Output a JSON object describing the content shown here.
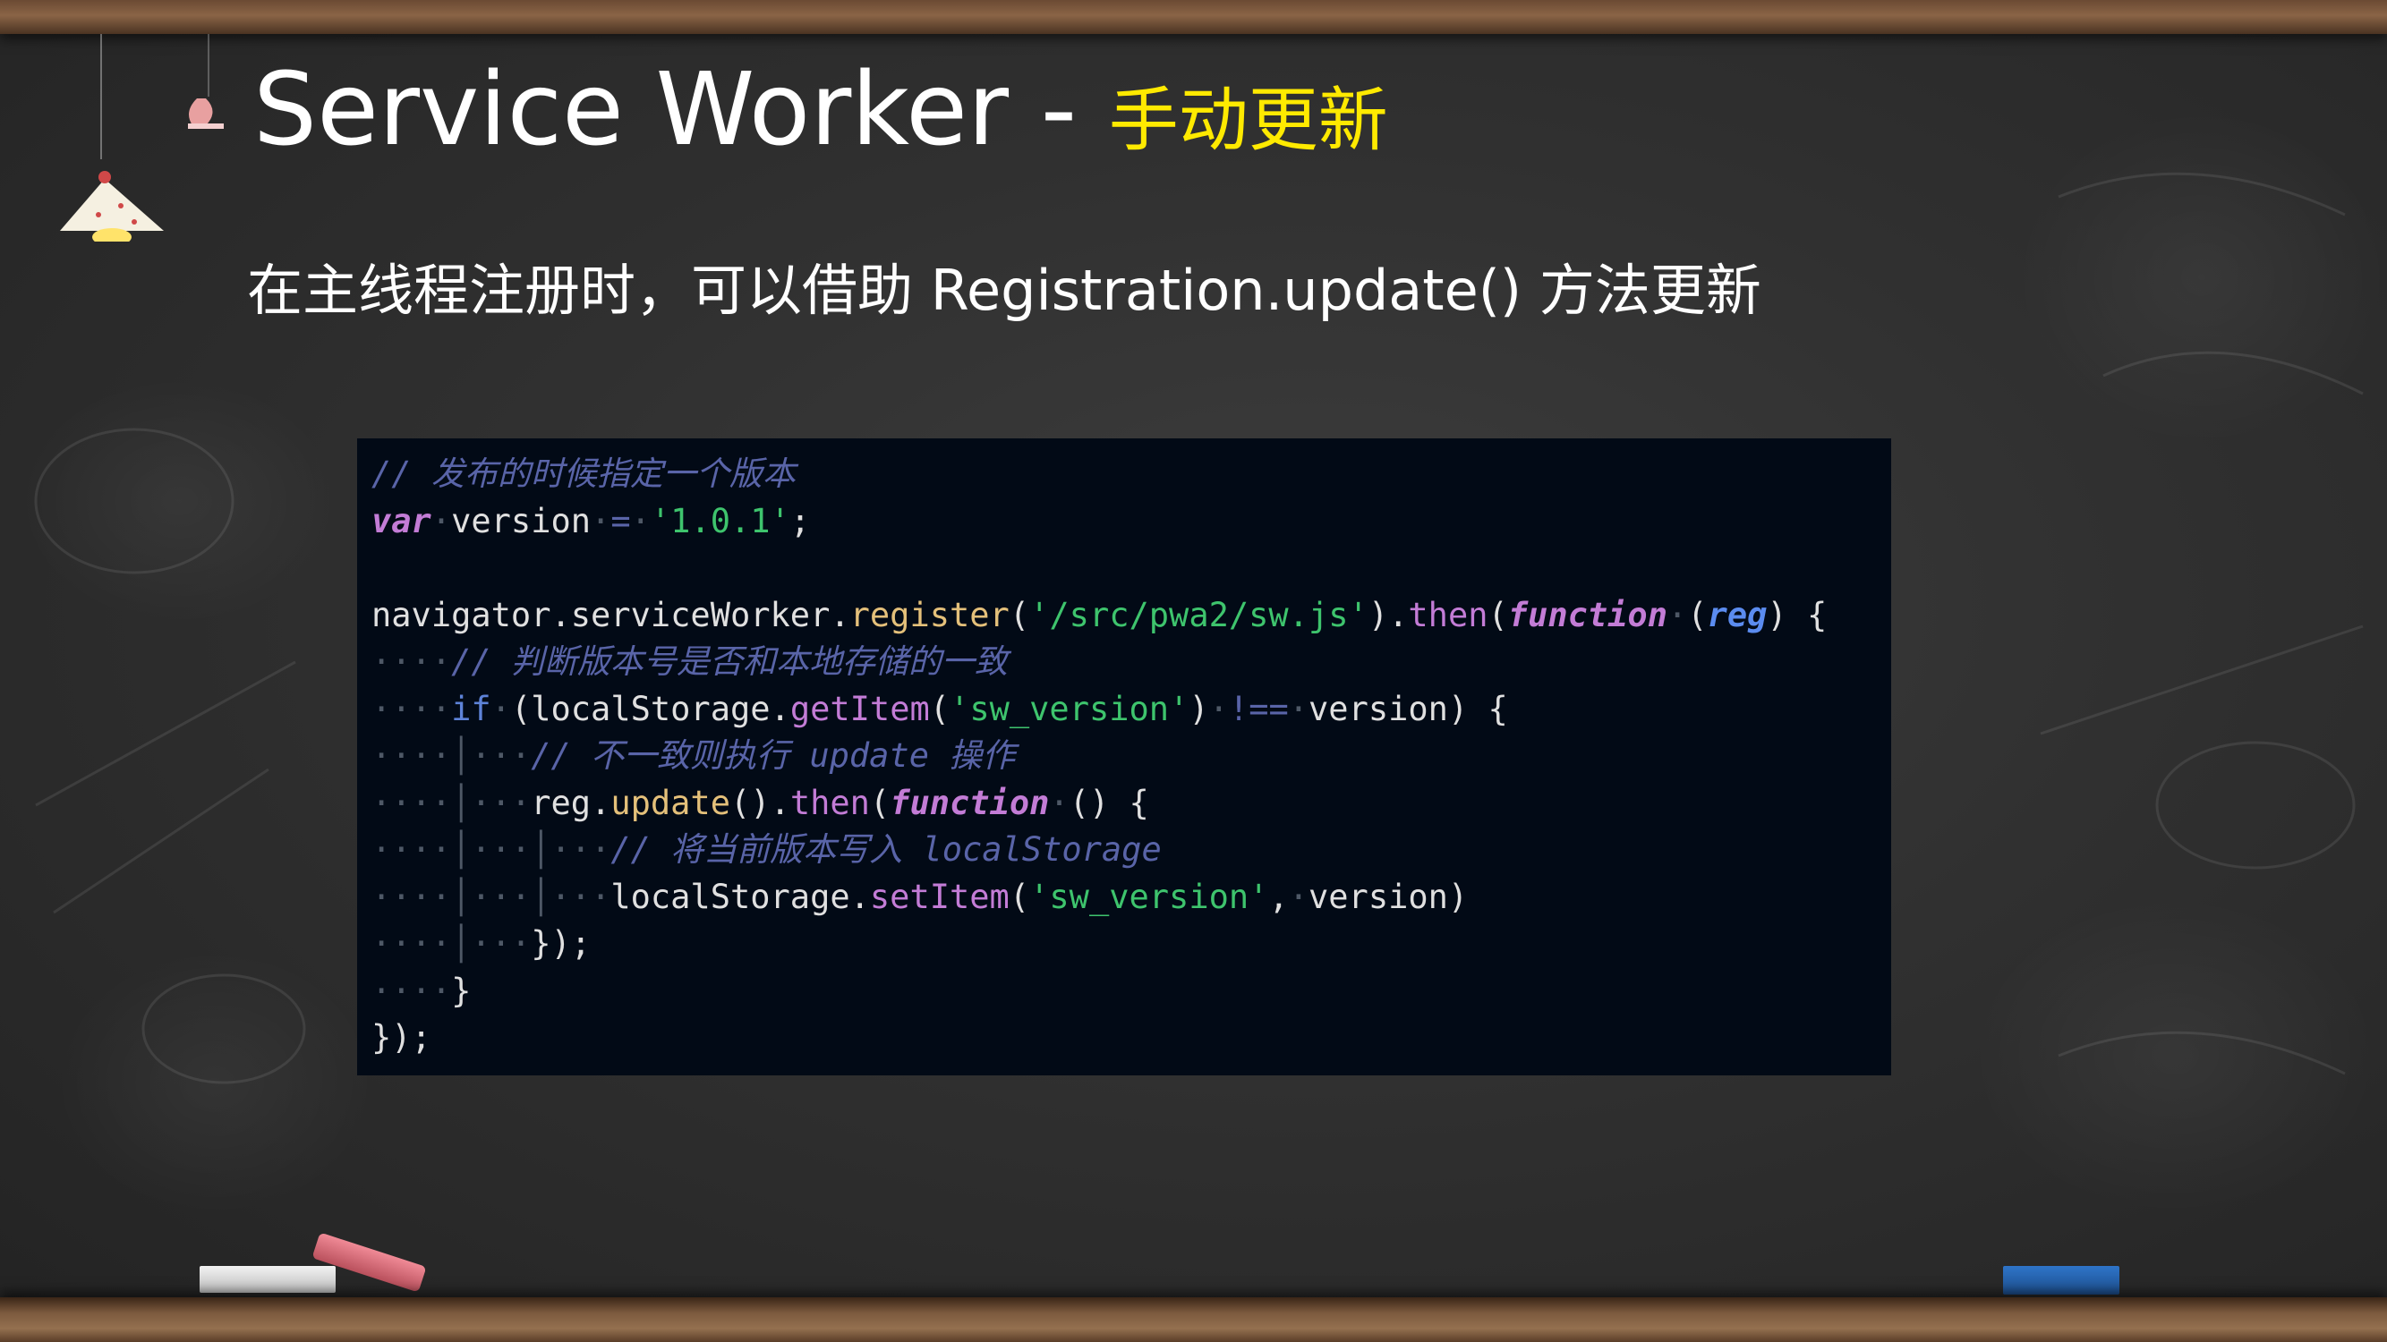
{
  "title": {
    "main": "Service Worker - ",
    "accent": "手动更新"
  },
  "subtitle": "在主线程注册时，可以借助 Registration.update() 方法更新",
  "code": {
    "l1_comment": "// 发布的时候指定一个版本",
    "l2_var": "var",
    "l2_name": "version",
    "l2_eq": "=",
    "l2_str": "'1.0.1'",
    "l2_semi": ";",
    "l4_obj": "navigator.serviceWorker.",
    "l4_fn": "register",
    "l4_open": "(",
    "l4_str": "'/src/pwa2/sw.js'",
    "l4_close": ").",
    "l4_then": "then",
    "l4_open2": "(",
    "l4_function": "function",
    "l4_open3": "(",
    "l4_param": "reg",
    "l4_close3": ") {",
    "l5_comment": "// 判断版本号是否和本地存储的一致",
    "l6_if": "if",
    "l6_open": "(localStorage.",
    "l6_fn": "getItem",
    "l6_open2": "(",
    "l6_str": "'sw_version'",
    "l6_close2": ")",
    "l6_op": "!==",
    "l6_rest": "version) {",
    "l7_comment": "// 不一致则执行 update 操作",
    "l8_obj": "reg.",
    "l8_fn": "update",
    "l8_mid": "().",
    "l8_then": "then",
    "l8_open": "(",
    "l8_function": "function",
    "l8_rest": "() {",
    "l9_comment": "// 将当前版本写入 localStorage",
    "l10_obj": "localStorage.",
    "l10_fn": "setItem",
    "l10_open": "(",
    "l10_str": "'sw_version'",
    "l10_comma": ",",
    "l10_rest": "version)",
    "l11": "});",
    "l12": "}",
    "l13": "});"
  },
  "colors": {
    "title": "#ffffff",
    "accent": "#ffea00",
    "code_bg": "#020a16"
  }
}
